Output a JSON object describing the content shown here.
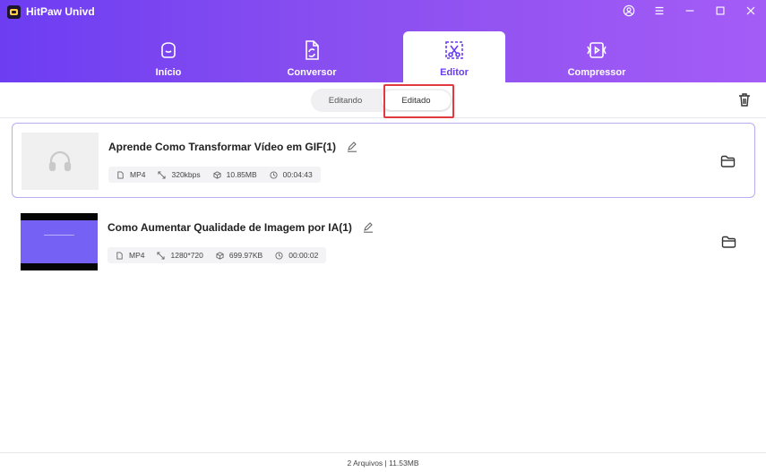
{
  "app": {
    "title": "HitPaw Univd"
  },
  "window_controls": [
    "account-icon",
    "menu-icon",
    "minimize-icon",
    "maximize-icon",
    "close-icon"
  ],
  "tabs": [
    {
      "label": "Início",
      "icon": "home-smile-icon"
    },
    {
      "label": "Conversor",
      "icon": "convert-file-icon"
    },
    {
      "label": "Editor",
      "icon": "scissors-frame-icon",
      "active": true
    },
    {
      "label": "Compressor",
      "icon": "compress-video-icon"
    }
  ],
  "segment": {
    "items": [
      "Editando",
      "Editado"
    ],
    "selected": "Editado"
  },
  "files": [
    {
      "name": "Aprende Como Transformar Vídeo em GIF(1)",
      "thumb": "audio-placeholder",
      "format": "MP4",
      "quality": "320kbps",
      "size": "10.85MB",
      "duration": "00:04:43"
    },
    {
      "name": "Como Aumentar Qualidade de Imagem por IA(1)",
      "thumb": "video-frame",
      "format": "MP4",
      "quality": "1280*720",
      "size": "699.97KB",
      "duration": "00:00:02"
    }
  ],
  "footer": {
    "summary": "2 Arquivos | 11.53MB"
  },
  "colors": {
    "accent": "#6a3cf0",
    "highlight": "#e0393e",
    "header_start": "#6d3df2",
    "header_end": "#a45cf6"
  }
}
